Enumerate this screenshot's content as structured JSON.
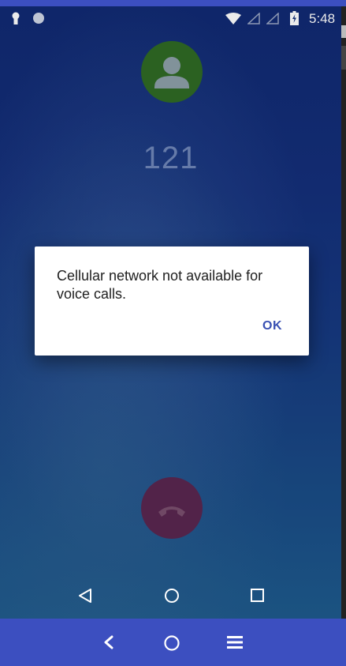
{
  "status_bar": {
    "time": "5:48",
    "icons": [
      "keyhole-icon",
      "circle-icon",
      "wifi-icon",
      "signal-icon",
      "signal-icon",
      "battery-icon"
    ]
  },
  "call": {
    "number": "121",
    "avatar_icon": "person-icon",
    "end_call_icon": "end-call-icon"
  },
  "dialog": {
    "message": "Cellular network not available for voice calls.",
    "ok_label": "OK"
  },
  "nav": {
    "icons": [
      "back-icon",
      "home-icon",
      "recents-icon"
    ]
  },
  "outer_nav": {
    "icons": [
      "back-chevron-icon",
      "home-circle-icon",
      "menu-icon"
    ]
  },
  "colors": {
    "frame": "#3c4fc0",
    "background_top": "#112a73",
    "background_bottom": "#1e5a8c",
    "avatar": "#2f6a24",
    "end_call": "#5a2750",
    "dialog_button": "#3950b3"
  }
}
